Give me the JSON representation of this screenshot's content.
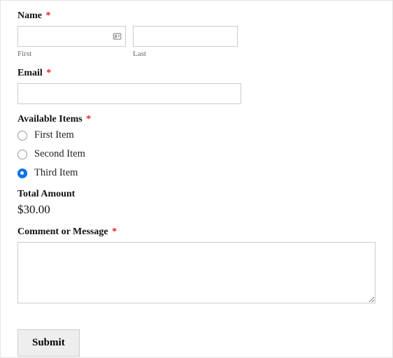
{
  "name": {
    "label": "Name",
    "first_sublabel": "First",
    "last_sublabel": "Last",
    "first_value": "",
    "last_value": ""
  },
  "email": {
    "label": "Email",
    "value": ""
  },
  "items": {
    "label": "Available Items",
    "options": [
      {
        "label": "First Item",
        "selected": false
      },
      {
        "label": "Second Item",
        "selected": false
      },
      {
        "label": "Third Item",
        "selected": true
      }
    ]
  },
  "total": {
    "label": "Total Amount",
    "value": "$30.00"
  },
  "comment": {
    "label": "Comment or Message",
    "value": ""
  },
  "submit_label": "Submit",
  "required_mark": "*"
}
